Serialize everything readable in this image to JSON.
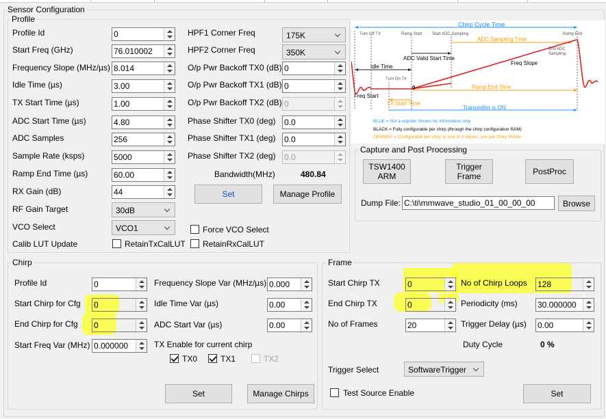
{
  "colors": {
    "background": "#f0f0f0",
    "highlight": "#fbff3b",
    "link_blue": "#0b4fbf",
    "diagram_blue": "#1e90ff",
    "diagram_orange": "#ff9900",
    "diagram_red": "#e02020"
  },
  "sensor_config": {
    "title": "Sensor Configuration"
  },
  "profile": {
    "title": "Profile",
    "profile_id": {
      "label": "Profile Id",
      "value": "0"
    },
    "start_freq": {
      "label": "Start Freq (GHz)",
      "value": "76.010002"
    },
    "freq_slope": {
      "label": "Frequency Slope (MHz/µs)",
      "value": "8.014"
    },
    "idle_time": {
      "label": "Idle Time (µs)",
      "value": "3.00"
    },
    "tx_start_time": {
      "label": "TX Start Time (µs)",
      "value": "1.00"
    },
    "adc_start_time": {
      "label": "ADC Start Time (µs)",
      "value": "4.80"
    },
    "adc_samples": {
      "label": "ADC Samples",
      "value": "256"
    },
    "sample_rate": {
      "label": "Sample Rate (ksps)",
      "value": "5000"
    },
    "ramp_end_time": {
      "label": "Ramp End Time (µs)",
      "value": "60.00"
    },
    "rx_gain": {
      "label": "RX Gain (dB)",
      "value": "44"
    },
    "rf_gain_target": {
      "label": "RF Gain Target",
      "value": "30dB"
    },
    "vco_select": {
      "label": "VCO Select",
      "value": "VCO1"
    },
    "calib_lut": {
      "label": "Calib LUT Update"
    },
    "hpf1": {
      "label": "HPF1 Corner Freq",
      "value": "175K"
    },
    "hpf2": {
      "label": "HPF2 Corner Freq",
      "value": "350K"
    },
    "pwr_tx0": {
      "label": "O/p Pwr Backoff TX0 (dB)",
      "value": "0"
    },
    "pwr_tx1": {
      "label": "O/p Pwr Backoff TX1 (dB)",
      "value": "0"
    },
    "pwr_tx2": {
      "label": "O/p Pwr Backoff TX2 (dB)",
      "value": "0"
    },
    "ps_tx0": {
      "label": "Phase Shifter TX0 (deg)",
      "value": "0.0"
    },
    "ps_tx1": {
      "label": "Phase Shifter TX1 (deg)",
      "value": "0.0"
    },
    "ps_tx2": {
      "label": "Phase Shifter TX2 (deg)",
      "value": "0.0"
    },
    "bandwidth": {
      "label": "Bandwidth(MHz)",
      "value": "480.84"
    },
    "set_label": "Set",
    "manage_label": "Manage Profile",
    "force_vco": {
      "label": "Force VCO Select",
      "checked": false
    },
    "retain_tx": {
      "label": "RetainTxCalLUT",
      "checked": false
    },
    "retain_rx": {
      "label": "RetainRxCalLUT",
      "checked": false
    }
  },
  "diagram": {
    "chirp_cycle_time": "Chirp Cycle Time",
    "turn_off_tx": "Turn Off TX",
    "ramp_start": "Ramp Start",
    "start_adc_sampling": "Start ADC Sampling",
    "ramp_end": "Ramp End",
    "adc_sampling_time": "ADC Sampling Time",
    "end_adc_sampling": "End ADC Sampling",
    "adc_valid_start_time": "ADC Valid Start Time",
    "idle_time": "Idle Time",
    "freq_slope": "Freq Slope",
    "turn_on_tx": "Turn On TX",
    "zero": "0",
    "ramp_end_time": "Ramp End Time",
    "freq_start": "Freq Start",
    "tx_start_time": "TX Start Time",
    "transmitter_on": "Transmitter is ON",
    "legend_blue": "BLUE = Not a register  Shown for information only",
    "legend_black": "BLACK = Fully configurable per chirp (through the chirp configuration RAM)",
    "legend_orange": "ORANGE = Configurable per chirp to one of 4 values, one per Chirp Profile"
  },
  "capture": {
    "title": "Capture and Post Processing",
    "tsw_line1": "TSW1400",
    "tsw_line2": "ARM",
    "trigger_line1": "Trigger",
    "trigger_line2": "Frame",
    "postproc": "PostProc",
    "dump_label": "Dump File:",
    "dump_value": "C:\\ti\\mmwave_studio_01_00_00_00",
    "browse": "Browse"
  },
  "chirp": {
    "title": "Chirp",
    "profile_id": {
      "label": "Profile Id",
      "value": "0"
    },
    "start_chirp": {
      "label": "Start Chirp for Cfg",
      "value": "0"
    },
    "end_chirp": {
      "label": "End Chirp for Cfg",
      "value": "0"
    },
    "start_freq_var": {
      "label": "Start Freq Var (MHz)",
      "value": "0.000000"
    },
    "freq_slope_var": {
      "label": "Frequency Slope Var (MHz/µs)",
      "value": "0.000"
    },
    "idle_time_var": {
      "label": "Idle Time Var (µs)",
      "value": "0.00"
    },
    "adc_start_var": {
      "label": "ADC Start Var (µs)",
      "value": "0.00"
    },
    "tx_enable_label": "TX Enable for current chirp",
    "tx0": {
      "label": "TX0",
      "checked": true
    },
    "tx1": {
      "label": "TX1",
      "checked": true
    },
    "tx2": {
      "label": "TX2",
      "checked": false
    },
    "set_label": "Set",
    "manage_label": "Manage Chirps"
  },
  "frame": {
    "title": "Frame",
    "start_chirp_tx": {
      "label": "Start Chirp TX",
      "value": "0"
    },
    "end_chirp_tx": {
      "label": "End Chirp TX",
      "value": "0"
    },
    "num_frames": {
      "label": "No of Frames",
      "value": "20"
    },
    "chirp_loops": {
      "label": "No of Chirp Loops",
      "value": "128"
    },
    "periodicity": {
      "label": "Periodicity (ms)",
      "value": "30.000000"
    },
    "trigger_delay": {
      "label": "Trigger Delay (µs)",
      "value": "0.00"
    },
    "duty_cycle": {
      "label": "Duty Cycle",
      "value": "0 %"
    },
    "trigger_select": {
      "label": "Trigger Select",
      "value": "SoftwareTrigger"
    },
    "test_source": {
      "label": "Test Source Enable",
      "checked": false
    },
    "set_label": "Set"
  }
}
